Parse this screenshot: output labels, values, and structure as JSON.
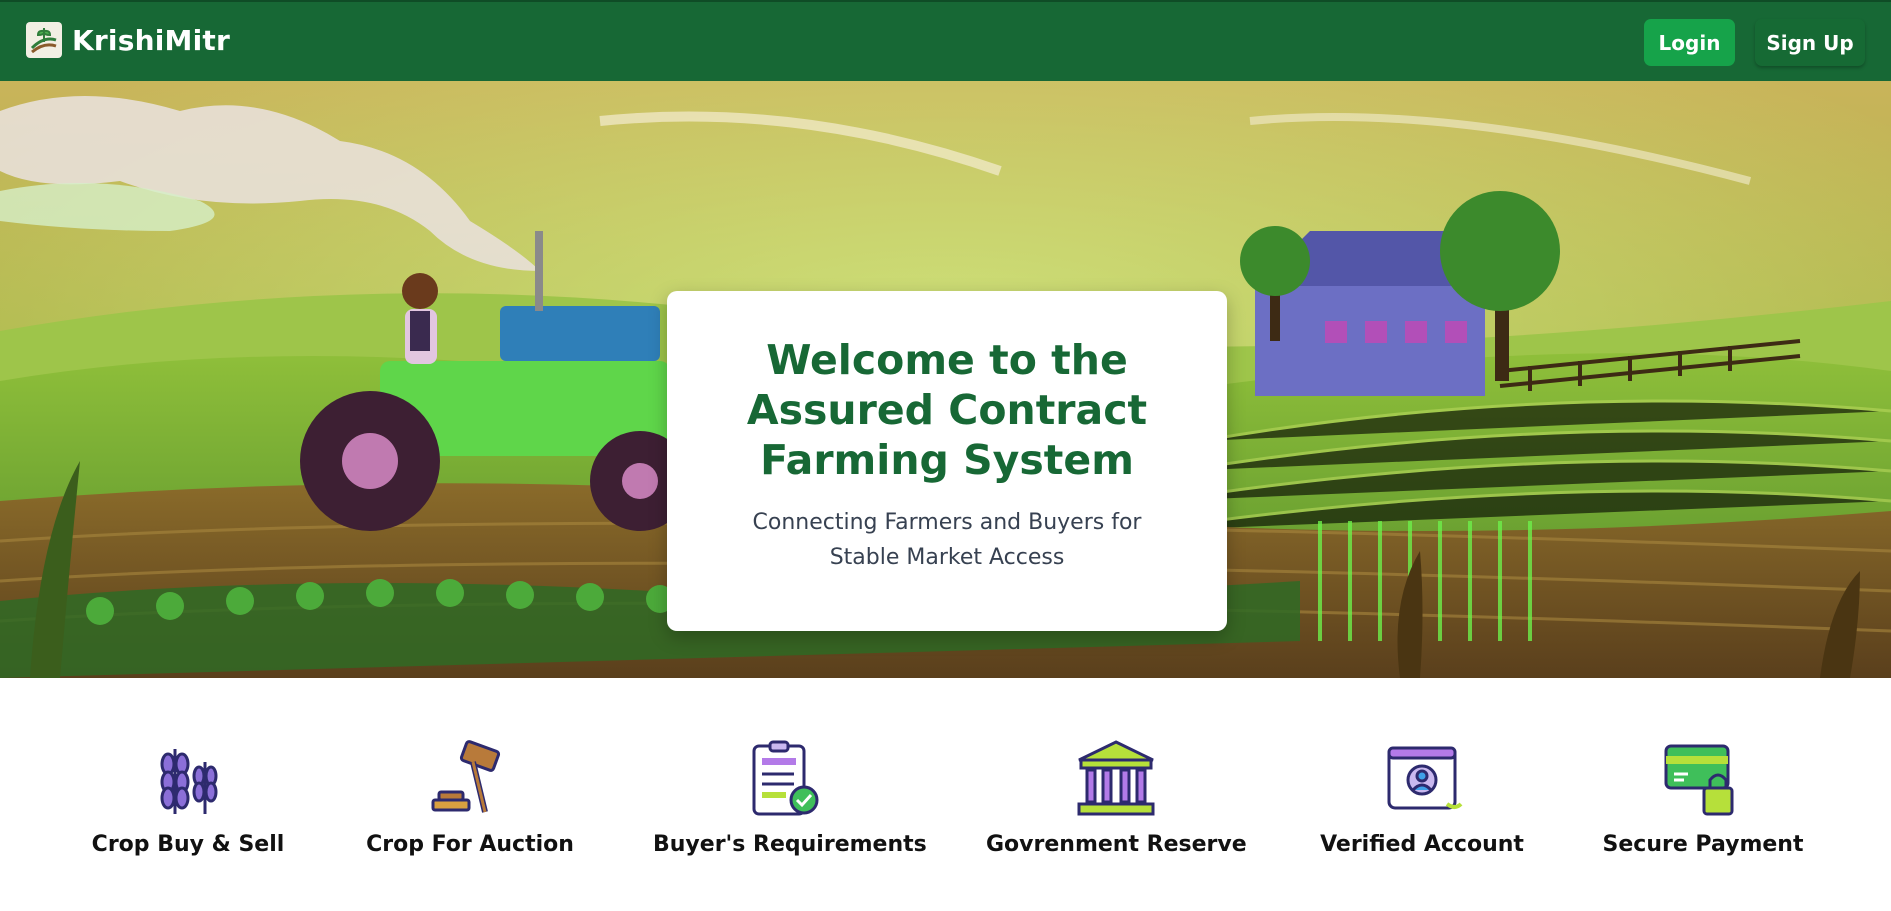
{
  "navbar": {
    "brand": "KrishiMitr",
    "login_label": "Login",
    "signup_label": "Sign Up"
  },
  "hero": {
    "title": "Welcome to the Assured Contract Farming System",
    "subtitle": "Connecting Farmers and Buyers for Stable Market Access"
  },
  "features": [
    {
      "label": "Crop Buy & Sell",
      "icon": "wheat-icon"
    },
    {
      "label": "Crop For Auction",
      "icon": "gavel-icon"
    },
    {
      "label": "Buyer's Requirements",
      "icon": "clipboard-check-icon"
    },
    {
      "label": "Govrenment Reserve",
      "icon": "government-building-icon"
    },
    {
      "label": "Verified Account",
      "icon": "verified-user-icon"
    },
    {
      "label": "Secure Payment",
      "icon": "secure-card-icon"
    }
  ],
  "colors": {
    "nav_bg": "#176835",
    "login_bg": "#16a34a",
    "title_green": "#176835",
    "icon_purple": "#3b2f8f"
  }
}
